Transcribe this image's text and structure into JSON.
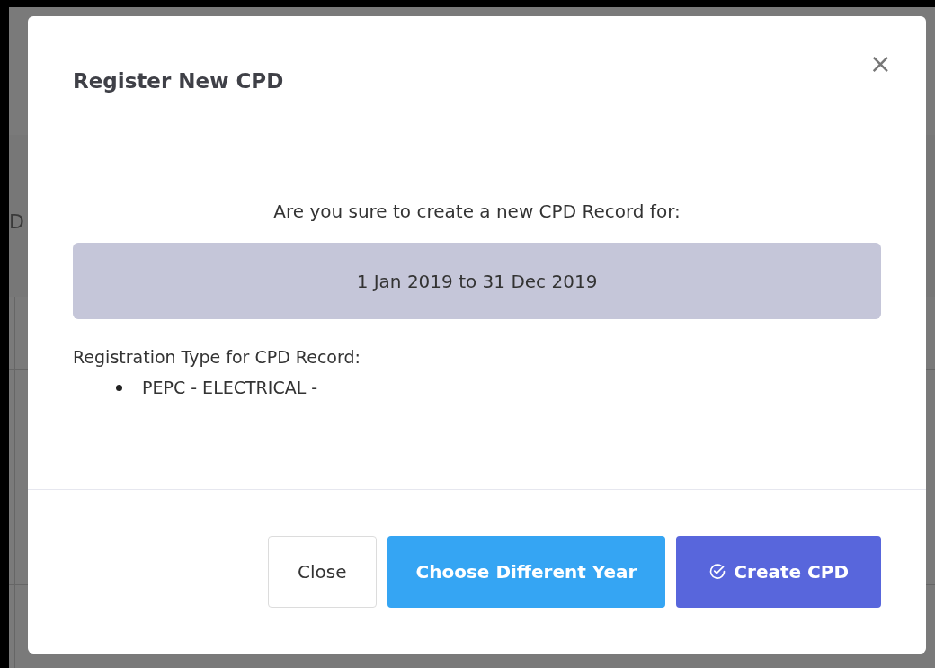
{
  "background": {
    "heading_fragment": "D"
  },
  "dialog": {
    "title": "Register New CPD",
    "close_icon": "×",
    "question": "Are you sure to create a new CPD Record for:",
    "period": "1 Jan 2019 to 31 Dec 2019",
    "registration_label": "Registration Type for CPD Record:",
    "registration_types": [
      "PEPC - ELECTRICAL -"
    ],
    "buttons": [
      {
        "label": "Close",
        "kind": "outline"
      },
      {
        "label": "Choose Different Year",
        "kind": "info"
      },
      {
        "label": "Create CPD",
        "kind": "primary"
      }
    ]
  }
}
